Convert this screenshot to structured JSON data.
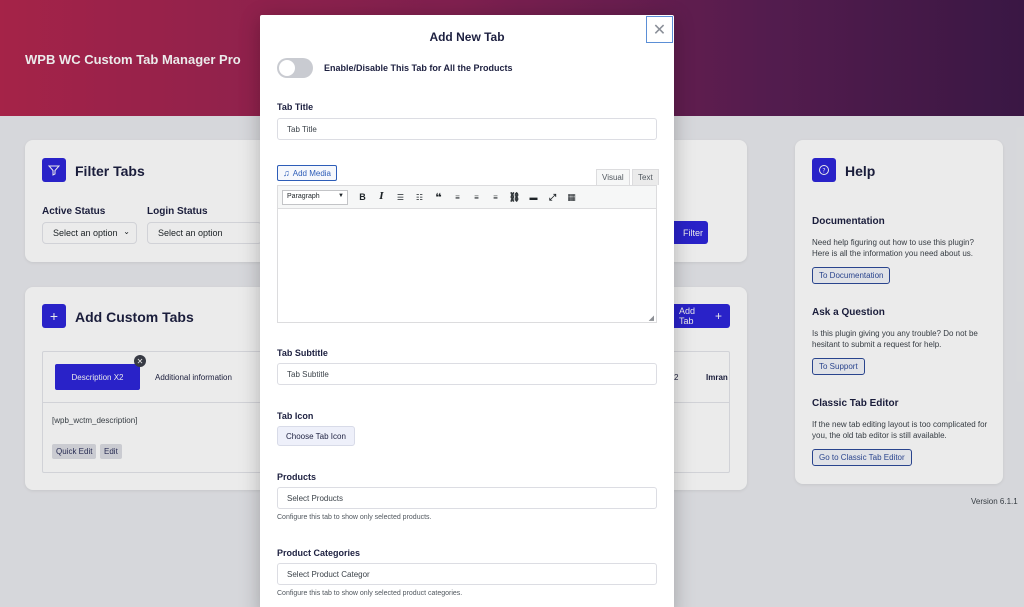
{
  "header": {
    "title": "WPB WC Custom Tab Manager Pro"
  },
  "filter": {
    "title": "Filter Tabs",
    "active_status_label": "Active Status",
    "active_status_value": "Select an option",
    "login_status_label": "Login Status",
    "login_status_value": "Select an option",
    "filter_button": "Filter"
  },
  "custom_tabs": {
    "title": "Add Custom Tabs",
    "add_tab_button": "Add Tab",
    "tabs": [
      "Description X2",
      "Additional information"
    ],
    "tab_right_1": "2",
    "tab_right_2": "Imran",
    "shortcode": "[wpb_wctm_description]",
    "quick_edit": "Quick Edit",
    "edit": "Edit"
  },
  "help": {
    "title": "Help",
    "doc_title": "Documentation",
    "doc_text": "Need help figuring out how to use this plugin? Here is all the information you need about us.",
    "doc_button": "To Documentation",
    "ask_title": "Ask a Question",
    "ask_text": "Is this plugin giving you any trouble? Do not be hesitant to submit a request for help.",
    "ask_button": "To Support",
    "classic_title": "Classic Tab Editor",
    "classic_text": "If the new tab editing layout is too complicated for you, the old tab editor is still available.",
    "classic_button": "Go to Classic Tab Editor",
    "version": "Version 6.1.1"
  },
  "modal": {
    "title": "Add New Tab",
    "toggle_label": "Enable/Disable This Tab for All the Products",
    "tab_title_label": "Tab Title",
    "tab_title_placeholder": "Tab Title",
    "add_media": "Add Media",
    "visual_tab": "Visual",
    "text_tab": "Text",
    "paragraph": "Paragraph",
    "tab_subtitle_label": "Tab Subtitle",
    "tab_subtitle_placeholder": "Tab Subtitle",
    "tab_icon_label": "Tab Icon",
    "choose_icon": "Choose Tab Icon",
    "products_label": "Products",
    "products_placeholder": "Select Products",
    "products_help": "Configure this tab to show only selected products.",
    "categories_label": "Product Categories",
    "categories_placeholder": "Select Product Categor",
    "categories_help": "Configure this tab to show only selected product categories."
  },
  "colors": {
    "accent": "#2d25d9",
    "header_start": "#b3264f",
    "header_end": "#3f1a4a"
  }
}
